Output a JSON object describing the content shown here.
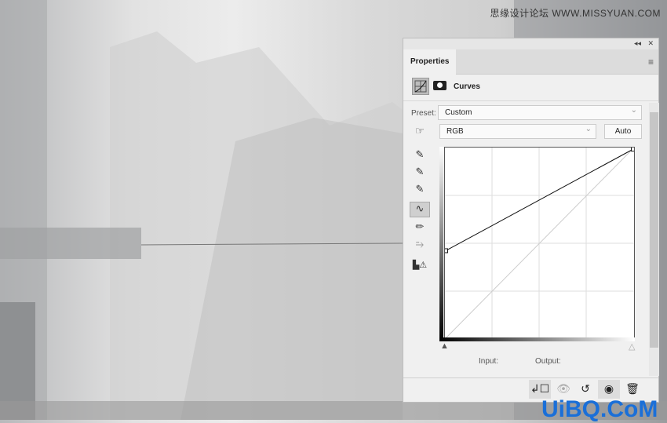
{
  "watermark": {
    "top": "思缘设计论坛 WWW.MISSYUAN.COM",
    "bottom": "UiBQ.CoM"
  },
  "panel": {
    "collapse": "◂◂",
    "close": "✕",
    "tab": "Properties",
    "menu_icon": "hamburger-icon",
    "title": "Curves",
    "preset_label": "Preset:",
    "preset_value": "Custom",
    "channel_value": "RGB",
    "auto_label": "Auto",
    "input_label": "Input:",
    "output_label": "Output:"
  },
  "curve": {
    "points": [
      [
        0,
        118
      ],
      [
        255,
        255
      ]
    ]
  },
  "tools": [
    "finger-adjust-icon",
    "black-eyedropper-icon",
    "gray-eyedropper-icon",
    "white-eyedropper-icon",
    "curve-points-icon",
    "pencil-icon",
    "smooth-icon",
    "clipping-warning-icon"
  ]
}
